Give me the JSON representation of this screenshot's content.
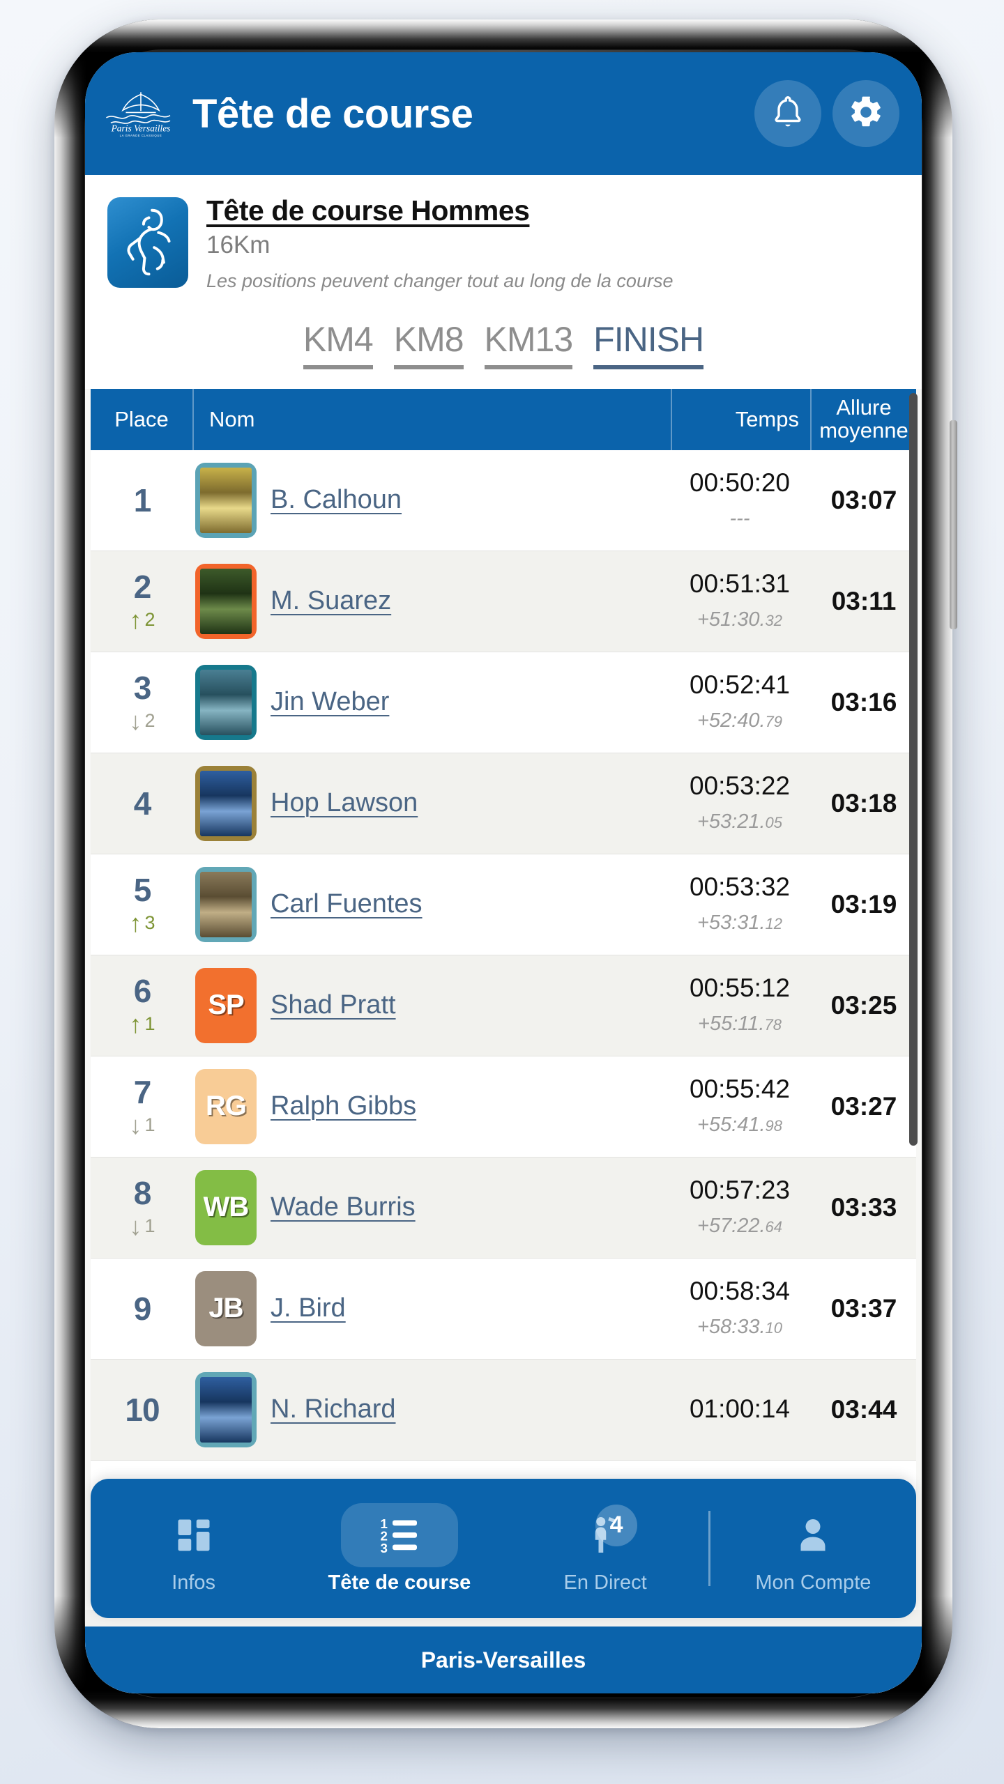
{
  "colors": {
    "brand_blue": "#0b63ab",
    "link_blue": "#4a6584",
    "row_alt": "#f2f2ee",
    "up_green": "#7d9434",
    "down_gray": "#a0a090"
  },
  "topbar": {
    "title": "Tête de course",
    "logo_alt": "Paris-Versailles",
    "logo_text": "Paris Versailles",
    "logo_subtext": "LA GRANDE CLASSIQUE",
    "notifications_icon": "bell-icon",
    "settings_icon": "gear-icon"
  },
  "race": {
    "title": "Tête de course Hommes",
    "distance": "16Km",
    "note": "Les positions peuvent changer tout au long de la course",
    "thumb_icon": "runner-icon"
  },
  "splits": [
    {
      "label": "KM4",
      "active": false
    },
    {
      "label": "KM8",
      "active": false
    },
    {
      "label": "KM13",
      "active": false
    },
    {
      "label": "FINISH",
      "active": true
    }
  ],
  "table": {
    "headers": {
      "place": "Place",
      "nom": "Nom",
      "temps": "Temps",
      "allure": "Allure\nmoyenne",
      "allure_line1": "Allure",
      "allure_line2": "moyenne"
    },
    "rows": [
      {
        "place": "1",
        "delta_dir": "",
        "delta_count": "",
        "name": "B. Calhoun",
        "avatar_type": "photo",
        "avatar_border": "#5ba3b5",
        "avatar_initials": "",
        "time": "00:50:20",
        "gap": "---",
        "gap_frac": "",
        "pace": "03:07"
      },
      {
        "place": "2",
        "delta_dir": "up",
        "delta_count": "2",
        "name": "M. Suarez",
        "avatar_type": "photo",
        "avatar_border": "#f2642a",
        "avatar_initials": "",
        "time": "00:51:31",
        "gap": "+51:30.",
        "gap_frac": "32",
        "pace": "03:11"
      },
      {
        "place": "3",
        "delta_dir": "down",
        "delta_count": "2",
        "name": "Jin Weber",
        "avatar_type": "photo",
        "avatar_border": "#16798c",
        "avatar_initials": "",
        "time": "00:52:41",
        "gap": "+52:40.",
        "gap_frac": "79",
        "pace": "03:16"
      },
      {
        "place": "4",
        "delta_dir": "",
        "delta_count": "",
        "name": "Hop Lawson",
        "avatar_type": "photo",
        "avatar_border": "#9b8138",
        "avatar_initials": "",
        "time": "00:53:22",
        "gap": "+53:21.",
        "gap_frac": "05",
        "pace": "03:18"
      },
      {
        "place": "5",
        "delta_dir": "up",
        "delta_count": "3",
        "name": "Carl Fuentes",
        "avatar_type": "photo",
        "avatar_border": "#61a7b6",
        "avatar_initials": "",
        "time": "00:53:32",
        "gap": "+53:31.",
        "gap_frac": "12",
        "pace": "03:19"
      },
      {
        "place": "6",
        "delta_dir": "up",
        "delta_count": "1",
        "name": "Shad Pratt",
        "avatar_type": "initials",
        "avatar_border": "#f2702e",
        "avatar_initials": "SP",
        "time": "00:55:12",
        "gap": "+55:11.",
        "gap_frac": "78",
        "pace": "03:25"
      },
      {
        "place": "7",
        "delta_dir": "down",
        "delta_count": "1",
        "name": "Ralph Gibbs",
        "avatar_type": "initials",
        "avatar_border": "#f8cc96",
        "avatar_initials": "RG",
        "time": "00:55:42",
        "gap": "+55:41.",
        "gap_frac": "98",
        "pace": "03:27"
      },
      {
        "place": "8",
        "delta_dir": "down",
        "delta_count": "1",
        "name": "Wade Burris",
        "avatar_type": "initials",
        "avatar_border": "#83bd45",
        "avatar_initials": "WB",
        "time": "00:57:23",
        "gap": "+57:22.",
        "gap_frac": "64",
        "pace": "03:33"
      },
      {
        "place": "9",
        "delta_dir": "",
        "delta_count": "",
        "name": "J. Bird",
        "avatar_type": "initials",
        "avatar_border": "#9b8e7e",
        "avatar_initials": "JB",
        "time": "00:58:34",
        "gap": "+58:33.",
        "gap_frac": "10",
        "pace": "03:37"
      },
      {
        "place": "10",
        "delta_dir": "",
        "delta_count": "",
        "name": "N. Richard",
        "avatar_type": "photo",
        "avatar_border": "#61a7b6",
        "avatar_initials": "",
        "time": "01:00:14",
        "gap": "",
        "gap_frac": "",
        "pace": "03:44"
      }
    ]
  },
  "bottomnav": {
    "items": [
      {
        "label": "Infos",
        "icon": "dashboard-icon",
        "active": false,
        "badge": ""
      },
      {
        "label": "Tête de course",
        "icon": "ranking-list-icon",
        "active": true,
        "badge": ""
      },
      {
        "label": "En Direct",
        "icon": "live-person-icon",
        "active": false,
        "badge": "4"
      },
      {
        "label": "Mon Compte",
        "icon": "person-icon",
        "active": false,
        "badge": ""
      }
    ]
  },
  "footer": {
    "text": "Paris-Versailles"
  }
}
